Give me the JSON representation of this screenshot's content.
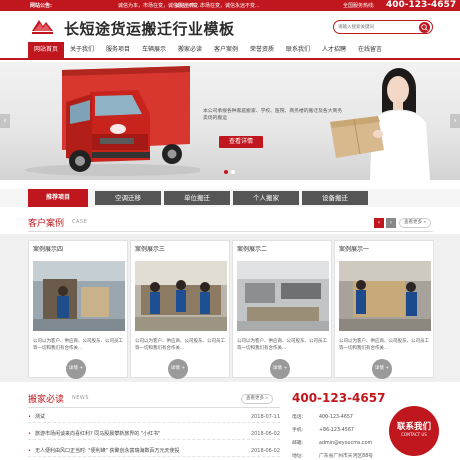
{
  "topbar": {
    "notice_label": "网站公告:",
    "notice_1": "诚信为本，市场在变，诚信永远不变...",
    "notice_2": "诚信为本，市场在变，诚信永远不变...",
    "hotline_label": "全国服务热线:",
    "hotline": "400-123-4657"
  },
  "header": {
    "site_title": "长短途货运搬迁行业模板",
    "search_placeholder": "请输入搜索关键词"
  },
  "nav": {
    "items": [
      "网站首页",
      "关于我们",
      "服务项目",
      "车辆展示",
      "搬家必读",
      "客户案例",
      "荣誉资质",
      "联系我们",
      "人才招聘",
      "在线留言"
    ],
    "active_index": 0
  },
  "banner": {
    "text": "本公司承接各种家庭搬家、学校、医院、商务楼的搬迁及各大商务卖场的搬运",
    "button": "查看详情",
    "prev": "‹",
    "next": "›",
    "slides": 2,
    "current_slide": 1
  },
  "services": {
    "tag": "推荐项目",
    "items": [
      "空调迁移",
      "单位搬迁",
      "个人搬家",
      "设备搬迁"
    ]
  },
  "cases": {
    "title": "客户案例",
    "title_en": "CASE",
    "prev": "‹",
    "next": "›",
    "more": "查看更多 »",
    "items": [
      {
        "title": "案例展示四",
        "desc": "公司以为客户、供应商、公司股东、公司员工等一切和我们有合作关...",
        "detail": "详情 +"
      },
      {
        "title": "案例展示三",
        "desc": "公司以为客户、供应商、公司股东、公司员工等一切和我们有合作关...",
        "detail": "详情 +"
      },
      {
        "title": "案例展示二",
        "desc": "公司以为客户、供应商、公司股东、公司员工等一切和我们有合作关...",
        "detail": "详情 +"
      },
      {
        "title": "案例展示一",
        "desc": "公司以为客户、供应商、公司股东、公司员工等一切和我们有合作关...",
        "detail": "详情 +"
      }
    ]
  },
  "news": {
    "title": "搬家必读",
    "title_en": "NEWS",
    "more": "查看更多 »",
    "items": [
      {
        "text": "测试",
        "date": "2018-07-11"
      },
      {
        "text": "旅游市场闲谈来向喜红利? 同马股晨攀新旅界的 \"小红书\"",
        "date": "2018-06-02"
      },
      {
        "text": "无人便利由风口正当时: \"便利蜂\" 获聚创永富瑞海数百万元天使投",
        "date": "2018-06-02"
      }
    ]
  },
  "contact": {
    "phone": "400-123-4657",
    "rows": [
      {
        "label": "电话:",
        "value": "400-123-4657"
      },
      {
        "label": "手机:",
        "value": "+86-123-4567"
      },
      {
        "label": "邮箱:",
        "value": "admin@eyoucms.com"
      },
      {
        "label": "地址:",
        "value": "广东省广州市天河区88号"
      }
    ],
    "badge_zh": "联系我们",
    "badge_en": "CONTACT US"
  },
  "colors": {
    "brand": "#c0171e",
    "service_tab": "#555555"
  }
}
